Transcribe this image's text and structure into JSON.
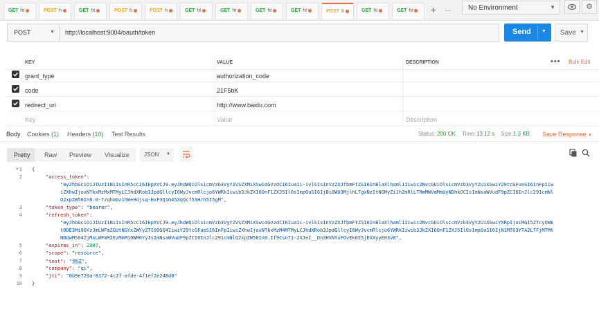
{
  "tabs": [
    {
      "method": "GET",
      "title": "ht",
      "dot": true
    },
    {
      "method": "POST",
      "title": "h",
      "dot": true
    },
    {
      "method": "GET",
      "title": "ht",
      "dot": true
    },
    {
      "method": "POST",
      "title": "h",
      "dot": true
    },
    {
      "method": "POST",
      "title": "h",
      "dot": true
    },
    {
      "method": "GET",
      "title": "ht",
      "dot": true
    },
    {
      "method": "GET",
      "title": "ht",
      "dot": true
    },
    {
      "method": "GET",
      "title": "ht",
      "dot": true
    },
    {
      "method": "GET",
      "title": "ht",
      "dot": true
    },
    {
      "method": "POST",
      "title": "h",
      "dot": true,
      "active": true
    },
    {
      "method": "GET",
      "title": "ht",
      "dot": true
    },
    {
      "method": "GET",
      "title": "ht",
      "dot": true
    }
  ],
  "tab_plus": "+",
  "tab_more": "···",
  "environment": {
    "selected": "No Environment"
  },
  "request": {
    "method": "POST",
    "url": "http://localhost:9004/oauth/token",
    "send_label": "Send",
    "save_label": "Save"
  },
  "params": {
    "headers": {
      "key": "KEY",
      "value": "VALUE",
      "description": "DESCRIPTION",
      "bulk_edit": "Bulk Edit"
    },
    "rows": [
      {
        "key": "grant_type",
        "value": "authorization_code",
        "checked": true
      },
      {
        "key": "code",
        "value": "21F5bK",
        "checked": true
      },
      {
        "key": "redirect_uri",
        "value": "http://www.baidu.com",
        "checked": true
      }
    ],
    "placeholder": {
      "key": "Key",
      "value": "Value",
      "description": "Description"
    }
  },
  "response_tabs": {
    "body": "Body",
    "cookies": "Cookies",
    "cookies_count": "(1)",
    "headers": "Headers",
    "headers_count": "(10)",
    "tests": "Test Results"
  },
  "response_meta": {
    "status_label": "Status:",
    "status_value": "200 OK",
    "time_label": "Time:",
    "time_value": "13.12 s",
    "size_label": "Size:",
    "size_value": "1.3 KB",
    "save_response": "Save Response"
  },
  "body_toolbar": {
    "pretty": "Pretty",
    "raw": "Raw",
    "preview": "Preview",
    "visualize": "Visualize",
    "format": "JSON"
  },
  "response_json": {
    "open_brace": "{",
    "close_brace": "}",
    "access_token_key": "\"access_token\":",
    "access_token_1": "\"eyJhbGciOiJIUzI1NiIsInR5cCI6IkpXVCJ9.eyJhdWQiOlsicmVzb3VyY2VSZXMiXSwidGVzdCI6Iua1i-ivlSIsInVzZXJfbmFtZSI6InBlaXlhaml1Iiwic2NvcGUiOlsicmVzb3VyY2UiXSwiY29tcGFueSI6InFpIiw",
    "access_token_2": "iZXhwIjoxNTkxMzMxMTMyLCJhdXRob3JpdGllcyI6WyJvcmRlcjo6YWRkIiwib3JkZXI6OnF1ZXJ5Il0sImp0aSI6IjBiOWU3MjlhLTgxNzItNGMyZi1hZmRlLTRmMWVmMmUyNDhkOCIsImNsaWVudF9pZCI6InJlc291cmNl",
    "access_token_3": "Q2xpZW50In0.0-7zqhmGz1hWeHdjsq-HxF3Q1G45XqQcf53Hrh5I5gM\",",
    "token_type_key": "\"token_type\":",
    "token_type_val": "\"bearer\"",
    "refresh_token_key": "\"refresh_token\":",
    "refresh_token_1": "\"eyJhbGciOiJIUzI1NiIsInR5cCI6IkpXVCJ9.eyJhdWQiOlsicmVzb3VyY2VSZXMiXSwidGVzdCI6Iua1i-ivlSIsInVzZXJfbmFtZSI6InBlaXlhaml1Iiwic2NvcGUiOlsicmVzb3VyY2UiXSwiYXRpIjoiMGI5ZTcyOWE",
    "refresh_token_2": "tODE3Mi00YzJmLWFmZGUtNGYxZWYyZTI0OGQ4IiwiY29tcGFueSI6InFpIiwiZXhwIjoxNTkxMzM4MTMyLCJhdXRob3JpdGllcyI6WyJvcmRlcjo6YWRkIiwib3JkZXI6OnF1ZXJ5Il0sImp0aSI6IjN1MTQ3YTA2LTFjMTMt",
    "refresh_token_3": "NDUwMS04ZjMxLWFmM2EzMmM1OWM0YyIsImNsaWVudF9pZCI6InJlc291cmNlQ2xpZW50In0.If9Csn71-2XJeI__Dn3HVNYxFOvEk025jEXXyyE83v0\",",
    "expires_in_key": "\"expires_in\":",
    "expires_in_val": "2987",
    "scope_key": "\"scope\":",
    "scope_val": "\"resource\"",
    "test_key": "\"test\":",
    "test_val": "\"测试\"",
    "company_key": "\"company\":",
    "company_val": "\"qi\"",
    "jti_key": "\"jti\":",
    "jti_val": "\"0b9e729a-8172-4c2f-afde-4f1ef2e248d8\""
  },
  "line_numbers": [
    "1",
    "2",
    "3",
    "4",
    "5",
    "6",
    "7",
    "8",
    "9",
    "10"
  ]
}
